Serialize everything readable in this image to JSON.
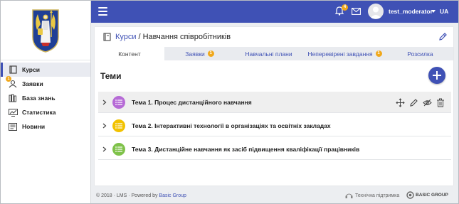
{
  "sidebar": {
    "items": [
      {
        "label": "Курси",
        "icon": "book-icon",
        "active": true
      },
      {
        "label": "Заявки",
        "icon": "requests-icon",
        "badge": "1"
      },
      {
        "label": "База знань",
        "icon": "library-icon"
      },
      {
        "label": "Статистика",
        "icon": "chart-icon"
      },
      {
        "label": "Новини",
        "icon": "news-icon"
      }
    ]
  },
  "topbar": {
    "notif_badge": "4",
    "username": "test_moderator",
    "lang": "UA"
  },
  "breadcrumb": {
    "link": "Курси",
    "separator": "/",
    "current": "Навчання співробітників"
  },
  "tabs": [
    {
      "label": "Контент",
      "active": true
    },
    {
      "label": "Заявки",
      "badge": "1"
    },
    {
      "label": "Навчальні плани"
    },
    {
      "label": "Неперевірені завдання",
      "badge": "1"
    },
    {
      "label": "Розсилка"
    }
  ],
  "content": {
    "title": "Теми",
    "topics": [
      {
        "title": "Тема 1. Процес дистанційного навчання",
        "color": "#b66bd6"
      },
      {
        "title": "Тема 2. Інтерактивні технології в організаціях та освітніх закладах",
        "color": "#f2c200"
      },
      {
        "title": "Тема 3. Дистанційне навчання як засіб підвищення кваліфікації працівників",
        "color": "#7fc24a"
      }
    ]
  },
  "footer": {
    "copyright": "© 2018 · LMS · Powered by ",
    "company": "Basic Group",
    "support": "Технічна підтримка",
    "logo_text": "BASIC GROUP"
  },
  "colors": {
    "primary": "#3f51b5",
    "badge": "#f0a81c"
  }
}
